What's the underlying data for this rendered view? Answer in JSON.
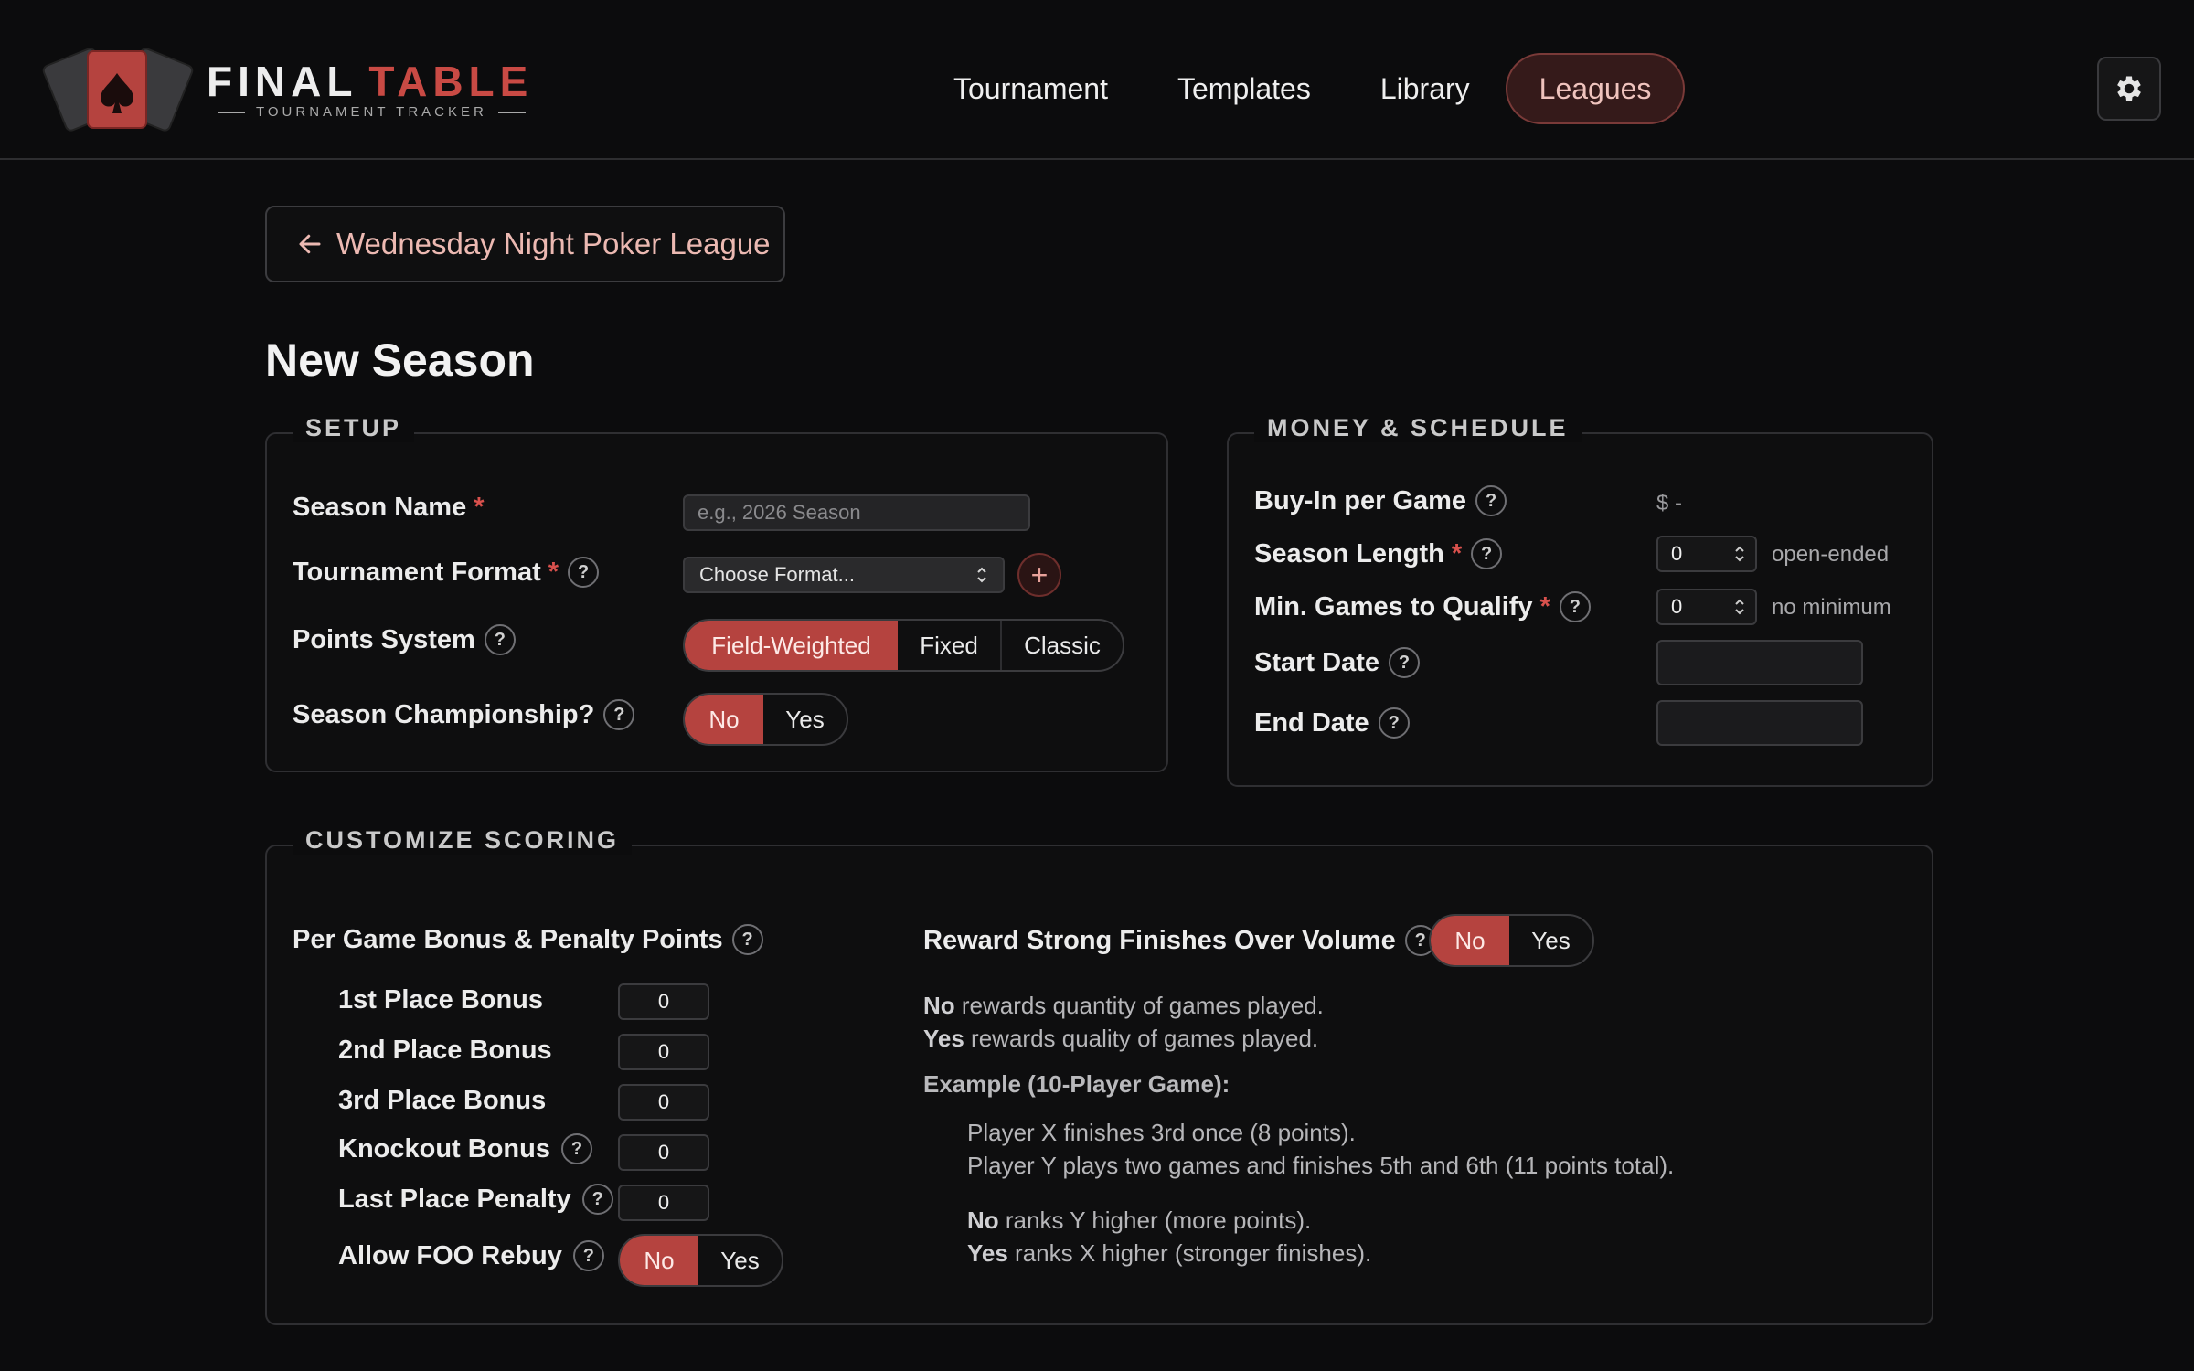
{
  "app": {
    "brand_word1": "FINAL",
    "brand_word2": "TABLE",
    "brand_tagline": "TOURNAMENT TRACKER",
    "accent_color": "#b5433f"
  },
  "nav": {
    "items": [
      {
        "label": "Tournament",
        "active": false
      },
      {
        "label": "Templates",
        "active": false
      },
      {
        "label": "Library",
        "active": false
      },
      {
        "label": "Leagues",
        "active": true
      }
    ],
    "settings_icon": "gear-icon"
  },
  "back_button": {
    "label": "Wednesday Night Poker League",
    "icon": "arrow-left-icon"
  },
  "page_title": "New Season",
  "setup": {
    "legend": "SETUP",
    "season_name": {
      "label": "Season Name",
      "required": "*",
      "placeholder": "e.g., 2026 Season",
      "value": ""
    },
    "tournament_format": {
      "label": "Tournament Format",
      "required": "*",
      "selected": "Choose Format...",
      "add_label": "+"
    },
    "points_system": {
      "label": "Points System",
      "options": [
        "Field-Weighted",
        "Fixed",
        "Classic"
      ],
      "selected": "Field-Weighted"
    },
    "championship": {
      "label": "Season Championship?",
      "options": [
        "No",
        "Yes"
      ],
      "selected": "No"
    }
  },
  "money": {
    "legend": "MONEY & SCHEDULE",
    "buy_in": {
      "label": "Buy-In per Game",
      "value": "$ -"
    },
    "season_length": {
      "label": "Season Length",
      "required": "*",
      "value": "0",
      "hint": "open-ended"
    },
    "min_games": {
      "label": "Min. Games to Qualify",
      "required": "*",
      "value": "0",
      "hint": "no minimum"
    },
    "start_date": {
      "label": "Start Date",
      "value": ""
    },
    "end_date": {
      "label": "End Date",
      "value": ""
    }
  },
  "scoring": {
    "legend": "CUSTOMIZE SCORING",
    "bonus_heading": "Per Game Bonus & Penalty Points",
    "bonuses": [
      {
        "label": "1st Place Bonus",
        "value": "0",
        "help": false
      },
      {
        "label": "2nd Place Bonus",
        "value": "0",
        "help": false
      },
      {
        "label": "3rd Place Bonus",
        "value": "0",
        "help": false
      },
      {
        "label": "Knockout Bonus",
        "value": "0",
        "help": true
      },
      {
        "label": "Last Place Penalty",
        "value": "0",
        "help": true
      }
    ],
    "foo_rebuy": {
      "label": "Allow FOO Rebuy",
      "options": [
        "No",
        "Yes"
      ],
      "selected": "No"
    },
    "reward": {
      "label": "Reward Strong Finishes Over Volume",
      "options": [
        "No",
        "Yes"
      ],
      "selected": "No",
      "line1_key": "No",
      "line1_text": " rewards quantity of games played.",
      "line2_key": "Yes",
      "line2_text": " rewards quality of games played.",
      "example_heading": "Example (10-Player Game):",
      "example_line1": "Player X finishes 3rd once (8 points).",
      "example_line2": "Player Y plays two games and finishes 5th and 6th (11 points total).",
      "result1_key": "No",
      "result1_text": " ranks Y higher (more points).",
      "result2_key": "Yes",
      "result2_text": " ranks X higher (stronger finishes)."
    }
  }
}
